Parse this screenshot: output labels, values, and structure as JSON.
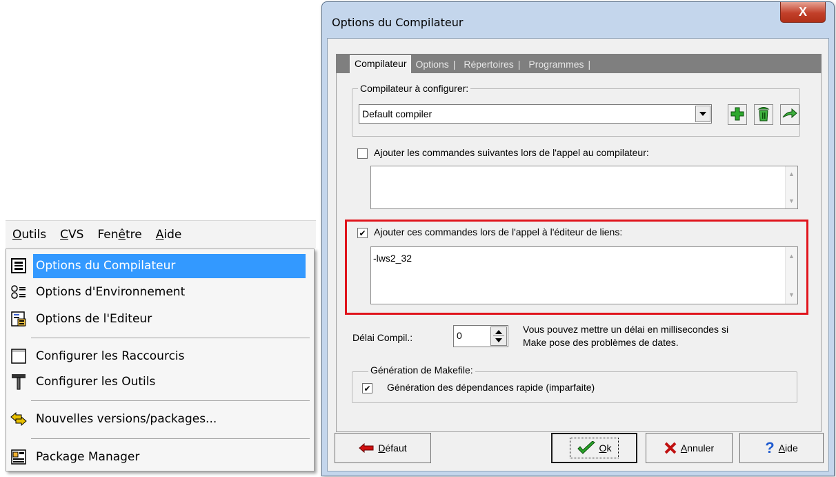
{
  "menubar": {
    "items": [
      {
        "pre": "",
        "ul": "O",
        "post": "utils"
      },
      {
        "pre": "",
        "ul": "C",
        "post": "VS"
      },
      {
        "pre": "Fen",
        "ul": "ê",
        "post": "tre"
      },
      {
        "pre": "",
        "ul": "A",
        "post": "ide"
      }
    ]
  },
  "menu": {
    "items": [
      {
        "label": "Options du Compilateur",
        "icon": "compiler-options-icon",
        "selected": true
      },
      {
        "label": "Options d'Environnement",
        "icon": "environment-options-icon"
      },
      {
        "label": "Options de l'Editeur",
        "icon": "editor-options-icon"
      },
      {
        "label": "Configurer les Raccourcis",
        "icon": "shortcuts-icon"
      },
      {
        "label": "Configurer les Outils",
        "icon": "hammer-icon"
      },
      {
        "label": "Nouvelles versions/packages...",
        "icon": "update-arrows-icon"
      },
      {
        "label": "Package Manager",
        "icon": "package-manager-icon"
      }
    ]
  },
  "dialog": {
    "title": "Options du Compilateur",
    "close": "X",
    "tabs": [
      {
        "label": "Compilateur"
      },
      {
        "label": "Options"
      },
      {
        "label": "Répertoires"
      },
      {
        "label": "Programmes"
      }
    ],
    "compiler_group": {
      "legend": "Compilateur à configurer:",
      "selected": "Default compiler"
    },
    "compile_cmds": {
      "label": "Ajouter les commandes suivantes lors de l'appel au compilateur:",
      "checked": false,
      "value": ""
    },
    "linker_cmds": {
      "label": "Ajouter ces commandes lors de l'appel à l'éditeur de liens:",
      "checked": true,
      "value": "-lws2_32"
    },
    "delay": {
      "label": "Délai Compil.:",
      "value": "0",
      "hint_line1": "Vous pouvez mettre un délai en millisecondes si",
      "hint_line2": "Make pose des problèmes de dates."
    },
    "makefile": {
      "legend": "Génération de Makefile:",
      "fast_deps_label": "Génération des dépendances rapide (imparfaite)",
      "fast_deps_checked": true
    },
    "buttons": {
      "default": {
        "ul": "D",
        "rest": "éfaut"
      },
      "ok": {
        "ul": "O",
        "rest": "k"
      },
      "cancel": {
        "ul": "A",
        "rest": "nnuler"
      },
      "help": {
        "ul": "A",
        "rest": "ide"
      }
    }
  },
  "colors": {
    "highlight": "#3399ff",
    "annotation_red": "#e0141c",
    "titlebar": "#c4d6ec"
  }
}
